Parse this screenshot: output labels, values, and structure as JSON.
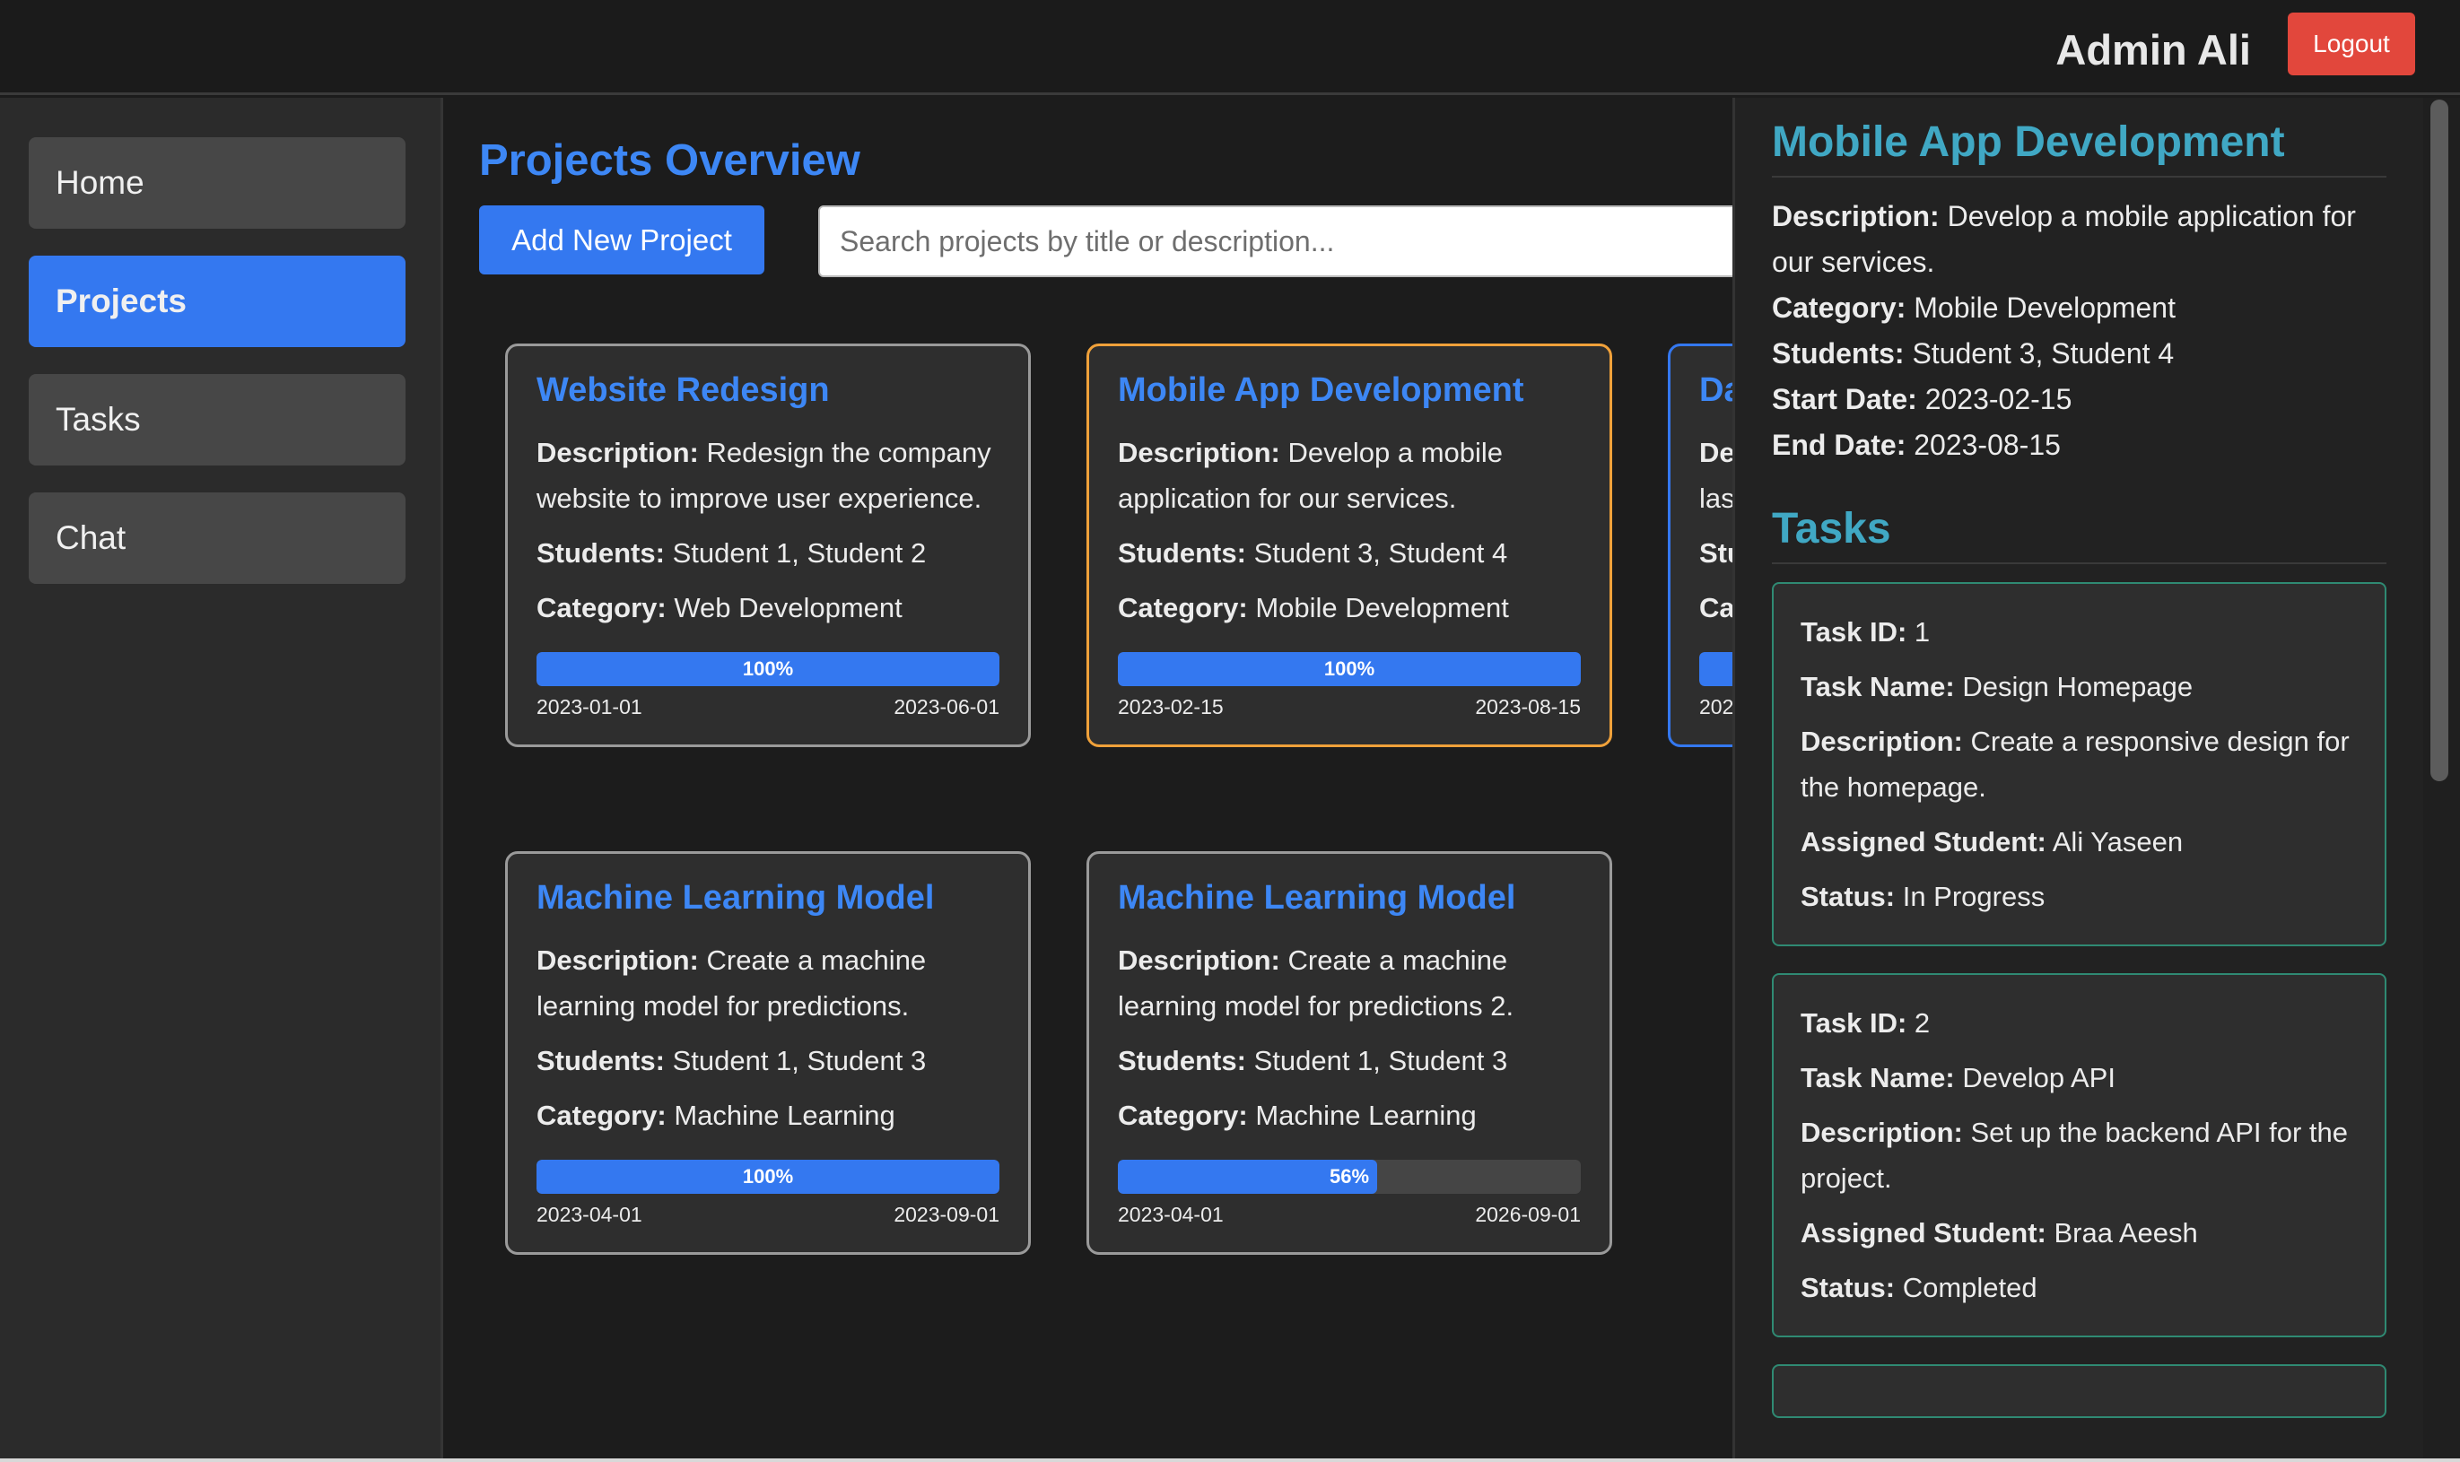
{
  "header": {
    "user_name": "Admin Ali",
    "logout_label": "Logout"
  },
  "sidebar": {
    "items": [
      {
        "label": "Home",
        "active": false
      },
      {
        "label": "Projects",
        "active": true
      },
      {
        "label": "Tasks",
        "active": false
      },
      {
        "label": "Chat",
        "active": false
      }
    ]
  },
  "main": {
    "title": "Projects Overview",
    "add_button": "Add New Project",
    "search_placeholder": "Search projects by title or description...",
    "labels": {
      "description": "Description:",
      "students": "Students:",
      "category": "Category:"
    },
    "projects": [
      {
        "title": "Website Redesign",
        "description": "Redesign the company website to improve user experience.",
        "students": "Student 1, Student 2",
        "category": "Web Development",
        "progress": 100,
        "progress_label": "100%",
        "start": "2023-01-01",
        "end": "2023-06-01"
      },
      {
        "title": "Mobile App Development",
        "description": "Develop a mobile application for our services.",
        "students": "Student 3, Student 4",
        "category": "Mobile Development",
        "progress": 100,
        "progress_label": "100%",
        "start": "2023-02-15",
        "end": "2023-08-15"
      },
      {
        "title": "Da",
        "description": "las",
        "students": "",
        "category": "",
        "progress": 100,
        "progress_label": "",
        "start": "202",
        "end": ""
      },
      {
        "title": "Machine Learning Model",
        "description": "Create a machine learning model for predictions.",
        "students": "Student 1, Student 3",
        "category": "Machine Learning",
        "progress": 100,
        "progress_label": "100%",
        "start": "2023-04-01",
        "end": "2023-09-01"
      },
      {
        "title": "Machine Learning Model",
        "description": "Create a machine learning model for predictions 2.",
        "students": "Student 1, Student 3",
        "category": "Machine Learning",
        "progress": 56,
        "progress_label": "56%",
        "start": "2023-04-01",
        "end": "2026-09-01"
      }
    ],
    "partial_labels": {
      "description": "De",
      "students": "Stu",
      "category": "Ca"
    }
  },
  "detail": {
    "title": "Mobile App Development",
    "labels": {
      "description": "Description:",
      "category": "Category:",
      "students": "Students:",
      "start": "Start Date:",
      "end": "End Date:"
    },
    "description": "Develop a mobile application for our services.",
    "category": "Mobile Development",
    "students": "Student 3, Student 4",
    "start": "2023-02-15",
    "end": "2023-08-15",
    "tasks_heading": "Tasks",
    "task_labels": {
      "id": "Task ID:",
      "name": "Task Name:",
      "description": "Description:",
      "student": "Assigned Student:",
      "status": "Status:"
    },
    "tasks": [
      {
        "id": "1",
        "name": "Design Homepage",
        "description": "Create a responsive design for the homepage.",
        "student": "Ali Yaseen",
        "status": "In Progress"
      },
      {
        "id": "2",
        "name": "Develop API",
        "description": "Set up the backend API for the project.",
        "student": "Braa Aeesh",
        "status": "Completed"
      }
    ]
  },
  "colors": {
    "accent": "#3478f0",
    "logout": "#e2473c",
    "detail_heading": "#40a8c4",
    "selected_card": "#f0a13a",
    "task_border": "#2f8a73"
  }
}
